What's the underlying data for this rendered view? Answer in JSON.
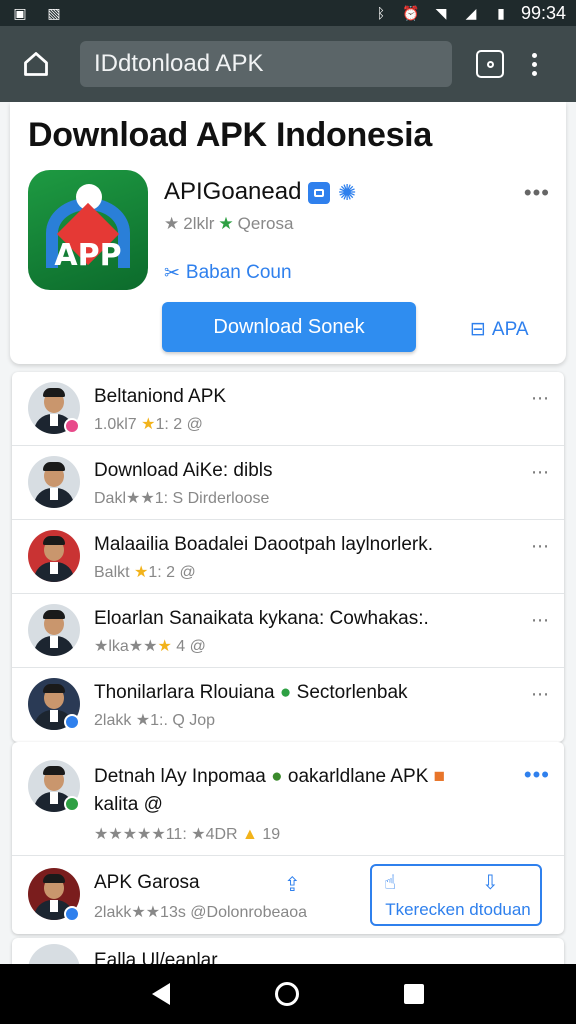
{
  "status_bar": {
    "time": "99:34",
    "icons": [
      "image-icon",
      "gallery-icon",
      "bluetooth-icon",
      "alarm-icon",
      "wifi-icon",
      "signal-icon",
      "battery-icon"
    ]
  },
  "toolbar": {
    "url": "IDdtonload APK"
  },
  "hero": {
    "title": "Download APK Indonesia",
    "app_icon_text": "APP",
    "app_name": "APIGoanead",
    "rating_text": "2lklr",
    "rating_source": "Qerosa",
    "developer": "Baban Coun",
    "download_button": "Download Sonek",
    "secondary_link": "APA",
    "colors": {
      "accent": "#2f8df0",
      "icon_green": "#1e9a42",
      "icon_red": "#e53935"
    }
  },
  "list1": {
    "items": [
      {
        "title": "Beltaniond APK",
        "meta_a": "1.0kl7",
        "meta_b": "1: 2 @",
        "more": "⋯",
        "badge_color": "#e84a8a"
      },
      {
        "title": "Download AiKe: dibls",
        "meta_a": "Dakl",
        "meta_b": "1: S Dirderloose",
        "more": "⋯",
        "badge_color": ""
      },
      {
        "title": "Malaailia Boadalei Daootpah laylnorlerk.",
        "meta_a": "Balkt",
        "meta_b": "1: 2 @",
        "more": "⋯",
        "badge_color": ""
      },
      {
        "title": "Eloarlan Sanaikata kykana: Cowhakas:.",
        "meta_a": "lka",
        "meta_b": "4 @",
        "more": "⋯",
        "badge_color": ""
      },
      {
        "title": "Thonilarlara Rlouiana",
        "title_extra": "Sectorlenbak",
        "meta_a": "2lakk",
        "meta_b": "1:. Q Jop",
        "more": "⋯",
        "badge_color": "#2f80ed"
      }
    ]
  },
  "list2": {
    "featured": {
      "title": "Detnah lAy Inpomaa",
      "title_extra": "oakarldlane APK",
      "title_line2": "kalita @",
      "meta": "11:",
      "meta_b": "4DR",
      "meta_c": "19",
      "more": "•••"
    },
    "last": {
      "title": "APK Garosa",
      "meta": "2lakk",
      "meta_b": "13s @Dolonrobeaoa",
      "cta_label": "Tkerecken dtoduan"
    }
  },
  "list3": {
    "partial_title": "Ealla Ul/eanlar"
  }
}
